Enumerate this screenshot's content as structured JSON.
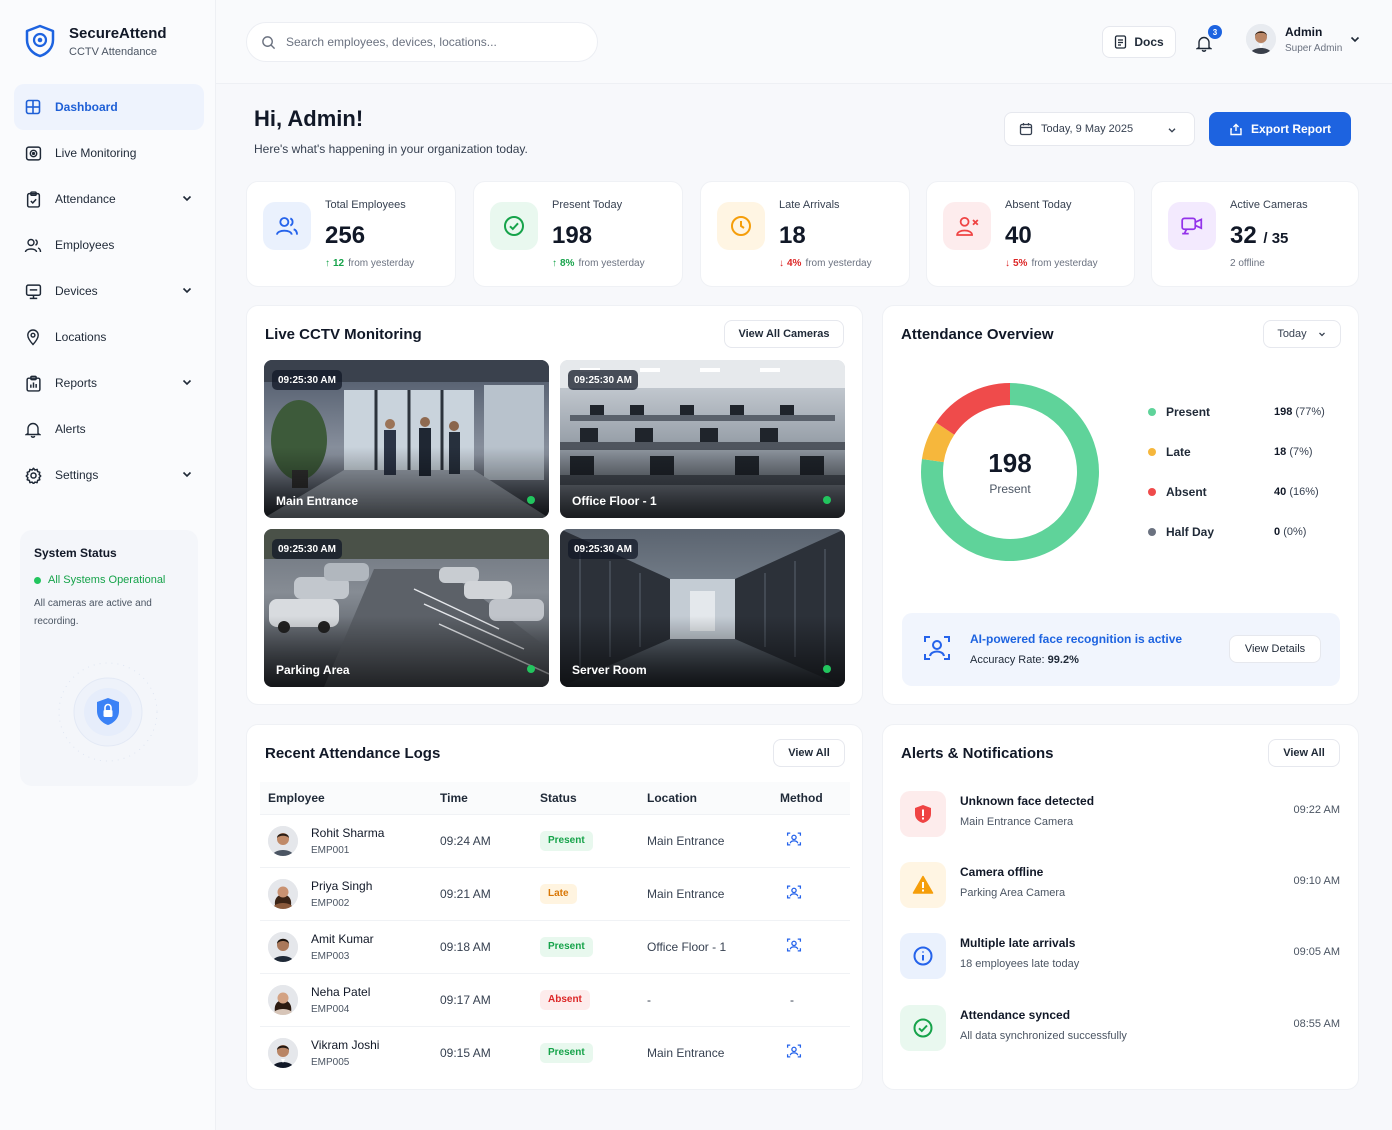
{
  "brand": {
    "name": "SecureAttend",
    "subtitle": "CCTV Attendance"
  },
  "nav": [
    {
      "label": "Dashboard",
      "icon": "grid-icon",
      "active": true
    },
    {
      "label": "Live Monitoring",
      "icon": "camera-icon"
    },
    {
      "label": "Attendance",
      "icon": "clipboard-icon",
      "chevron": true
    },
    {
      "label": "Employees",
      "icon": "users-icon"
    },
    {
      "label": "Devices",
      "icon": "monitor-icon",
      "chevron": true
    },
    {
      "label": "Locations",
      "icon": "map-pin-icon"
    },
    {
      "label": "Reports",
      "icon": "report-icon",
      "chevron": true
    },
    {
      "label": "Alerts",
      "icon": "bell-icon"
    },
    {
      "label": "Settings",
      "icon": "gear-icon",
      "chevron": true
    }
  ],
  "system_status": {
    "title": "System Status",
    "status": "All Systems Operational",
    "description": "All cameras are active and recording."
  },
  "search": {
    "placeholder": "Search employees, devices, locations..."
  },
  "topbar": {
    "docs_label": "Docs",
    "notification_count": "3",
    "user_name": "Admin",
    "user_role": "Super Admin"
  },
  "header": {
    "greeting": "Hi, Admin!",
    "subtitle": "Here's what's happening in your organization today.",
    "date": "Today, 9 May 2025",
    "export_label": "Export Report"
  },
  "stats": [
    {
      "label": "Total Employees",
      "value": "256",
      "trend_value": "12",
      "trend_text": "from yesterday",
      "trend": "up"
    },
    {
      "label": "Present Today",
      "value": "198",
      "trend_value": "8%",
      "trend_text": "from yesterday",
      "trend": "up"
    },
    {
      "label": "Late Arrivals",
      "value": "18",
      "trend_value": "4%",
      "trend_text": "from yesterday",
      "trend": "down"
    },
    {
      "label": "Absent Today",
      "value": "40",
      "trend_value": "5%",
      "trend_text": "from yesterday",
      "trend": "down"
    },
    {
      "label": "Active Cameras",
      "value": "32",
      "value_suffix": "/ 35",
      "trend_text": "2 offline",
      "trend": "warn"
    }
  ],
  "cctv": {
    "title": "Live CCTV Monitoring",
    "view_all": "View All Cameras",
    "cameras": [
      {
        "time": "09:25:30 AM",
        "name": "Main Entrance"
      },
      {
        "time": "09:25:30 AM",
        "name": "Office Floor - 1"
      },
      {
        "time": "09:25:30 AM",
        "name": "Parking Area"
      },
      {
        "time": "09:25:30 AM",
        "name": "Server Room"
      }
    ]
  },
  "overview": {
    "title": "Attendance Overview",
    "period": "Today",
    "center_value": "198",
    "center_label": "Present",
    "legend": [
      {
        "name": "Present",
        "count": "198",
        "pct": "(77%)",
        "color": "#5fd39a"
      },
      {
        "name": "Late",
        "count": "18",
        "pct": "(7%)",
        "color": "#f6b73c"
      },
      {
        "name": "Absent",
        "count": "40",
        "pct": "(16%)",
        "color": "#ef4b4b"
      },
      {
        "name": "Half Day",
        "count": "0",
        "pct": "(0%)",
        "color": "#6b7280"
      }
    ],
    "ai_title": "AI-powered face recognition is active",
    "ai_accuracy_label": "Accuracy Rate:",
    "ai_accuracy_value": "99.2%",
    "ai_button": "View Details"
  },
  "chart_data": {
    "type": "pie",
    "categories": [
      "Present",
      "Late",
      "Absent",
      "Half Day"
    ],
    "values": [
      198,
      18,
      40,
      0
    ],
    "title": "Attendance Overview"
  },
  "logs": {
    "title": "Recent Attendance Logs",
    "view_all": "View All",
    "columns": [
      "Employee",
      "Time",
      "Status",
      "Location",
      "Method"
    ],
    "rows": [
      {
        "name": "Rohit Sharma",
        "id": "EMP001",
        "time": "09:24 AM",
        "status": "Present",
        "location": "Main Entrance",
        "method": "face-scan-icon"
      },
      {
        "name": "Priya Singh",
        "id": "EMP002",
        "time": "09:21 AM",
        "status": "Late",
        "location": "Main Entrance",
        "method": "face-scan-icon"
      },
      {
        "name": "Amit Kumar",
        "id": "EMP003",
        "time": "09:18 AM",
        "status": "Present",
        "location": "Office Floor - 1",
        "method": "face-scan-icon"
      },
      {
        "name": "Neha Patel",
        "id": "EMP004",
        "time": "09:17 AM",
        "status": "Absent",
        "location": "-",
        "method": "-"
      },
      {
        "name": "Vikram Joshi",
        "id": "EMP005",
        "time": "09:15 AM",
        "status": "Present",
        "location": "Main Entrance",
        "method": "face-scan-icon"
      }
    ]
  },
  "alerts": {
    "title": "Alerts & Notifications",
    "view_all": "View All",
    "items": [
      {
        "title": "Unknown face detected",
        "subtitle": "Main Entrance Camera",
        "time": "09:22 AM",
        "kind": "danger"
      },
      {
        "title": "Camera offline",
        "subtitle": "Parking Area Camera",
        "time": "09:10 AM",
        "kind": "warning"
      },
      {
        "title": "Multiple late arrivals",
        "subtitle": "18 employees late today",
        "time": "09:05 AM",
        "kind": "info"
      },
      {
        "title": "Attendance synced",
        "subtitle": "All data synchronized successfully",
        "time": "08:55 AM",
        "kind": "success"
      }
    ]
  }
}
